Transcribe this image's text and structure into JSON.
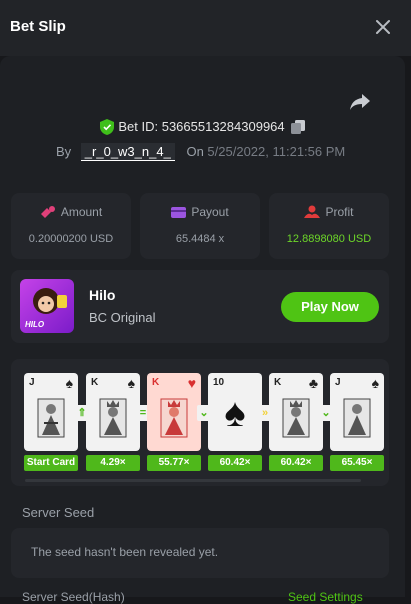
{
  "header": {
    "title": "Bet Slip",
    "close_icon": "close-icon"
  },
  "bet": {
    "id_label": "Bet ID:",
    "id_value": "53665513284309964",
    "by_label": "By",
    "username": "_r_0_w3_n_4_",
    "on_label": "On",
    "date": "5/25/2022, 11:21:56 PM"
  },
  "stats": {
    "amount": {
      "label": "Amount",
      "value": "0.20000200 USD",
      "icon": "coins-icon"
    },
    "payout": {
      "label": "Payout",
      "value": "65.4484 x",
      "icon": "wallet-icon"
    },
    "profit": {
      "label": "Profit",
      "value": "12.8898080 USD",
      "icon": "profit-icon",
      "color": "#6dd629"
    }
  },
  "game": {
    "name": "Hilo",
    "subtitle": "BC Original",
    "thumb_text": "HILO",
    "play_label": "Play Now"
  },
  "cards": [
    {
      "rank": "J",
      "suit": "♠",
      "caption": "Start Card"
    },
    {
      "rank": "K",
      "suit": "♠",
      "caption": "4.29×"
    },
    {
      "rank": "K",
      "suit": "♥",
      "caption": "55.77×"
    },
    {
      "rank": "10",
      "suit": "♠",
      "caption": "60.42×"
    },
    {
      "rank": "K",
      "suit": "♣",
      "caption": "60.42×"
    },
    {
      "rank": "J",
      "suit": "♠",
      "caption": "65.45×"
    }
  ],
  "arrows": [
    "⇑",
    "=",
    "⌄",
    "»",
    "⌄"
  ],
  "seed": {
    "label": "Server Seed",
    "placeholder": "The seed hasn't been revealed yet."
  },
  "bottom": {
    "left_text": "Server Seed(Hash)",
    "right_text": "Seed Settings"
  },
  "colors": {
    "accent": "#4fc414",
    "bg": "#17181b",
    "panel": "#24262b"
  }
}
